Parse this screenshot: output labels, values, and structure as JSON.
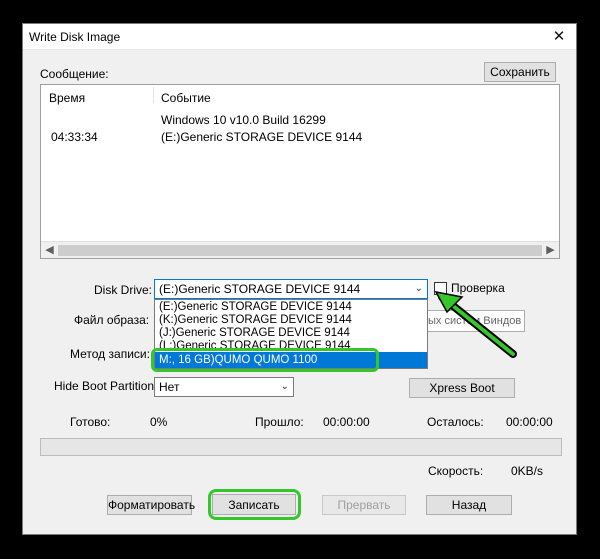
{
  "window": {
    "title": "Write Disk Image",
    "close_glyph": "✕"
  },
  "log": {
    "label": "Сообщение:",
    "save_button": "Сохранить",
    "col_time": "Время",
    "col_event": "Событие",
    "rows": [
      {
        "time": "",
        "event": "Windows 10 v10.0 Build 16299"
      },
      {
        "time": "04:33:34",
        "event": "(E:)Generic STORAGE DEVICE  9144"
      }
    ]
  },
  "disk_drive": {
    "label": "Disk Drive:",
    "value": "(E:)Generic STORAGE DEVICE  9144",
    "options": [
      "(E:)Generic STORAGE DEVICE  9144",
      "(K:)Generic STORAGE DEVICE  9144",
      "(J:)Generic STORAGE DEVICE  9144",
      "(L:)Generic STORAGE DEVICE  9144",
      "M:, 16 GB)QUMO     QUMO         1100"
    ],
    "selected_index": 4
  },
  "verify": {
    "label": "Проверка",
    "checked": false
  },
  "image_file": {
    "label": "Файл образа:",
    "obscured_text": "ых систем Виндов"
  },
  "write_method": {
    "label": "Метод записи:"
  },
  "hide_boot": {
    "label": "Hide Boot Partition:",
    "value": "Нет"
  },
  "xpress_boot": "Xpress Boot",
  "status": {
    "done_label": "Готово:",
    "done_value": "0%",
    "elapsed_label": "Прошло:",
    "elapsed_value": "00:00:00",
    "remaining_label": "Осталось:",
    "remaining_value": "00:00:00",
    "progress_fraction": 0,
    "speed_label": "Скорость:",
    "speed_value": "0KB/s"
  },
  "buttons": {
    "format": "Форматировать",
    "write": "Записать",
    "abort": "Прервать",
    "back": "Назад"
  },
  "colors": {
    "highlight": "#35c62b",
    "selection": "#0078d7"
  }
}
